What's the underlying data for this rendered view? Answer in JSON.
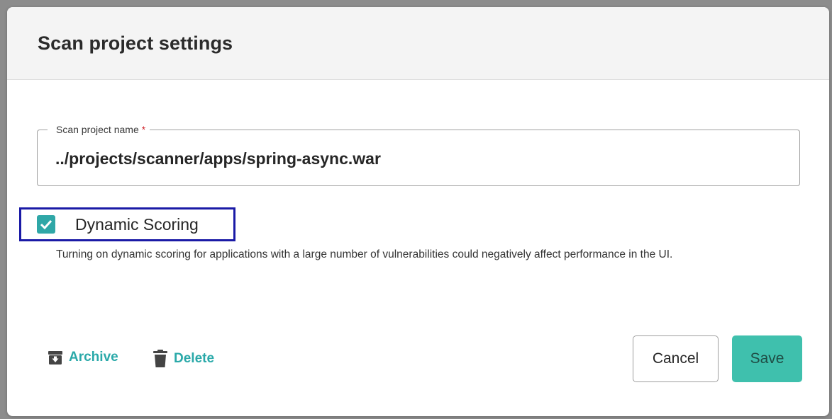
{
  "dialog": {
    "title": "Scan project settings"
  },
  "project_name_field": {
    "label": "Scan project name",
    "required_marker": "*",
    "value": "../projects/scanner/apps/spring-async.war"
  },
  "dynamic_scoring": {
    "label": "Dynamic Scoring",
    "checked": true,
    "help_text": "Turning on dynamic scoring for applications with a large number of vulnerabilities could negatively affect performance in the UI."
  },
  "footer": {
    "archive_label": "Archive",
    "delete_label": "Delete",
    "cancel_label": "Cancel",
    "save_label": "Save"
  },
  "icons": {
    "archive": "archive-box-icon",
    "delete": "trash-icon",
    "checkbox": "checkmark-icon"
  },
  "colors": {
    "accent": "#2fa7a7",
    "save_button": "#3fc0ad",
    "focus_outline": "#1a1aa6",
    "required": "#d0262e"
  }
}
